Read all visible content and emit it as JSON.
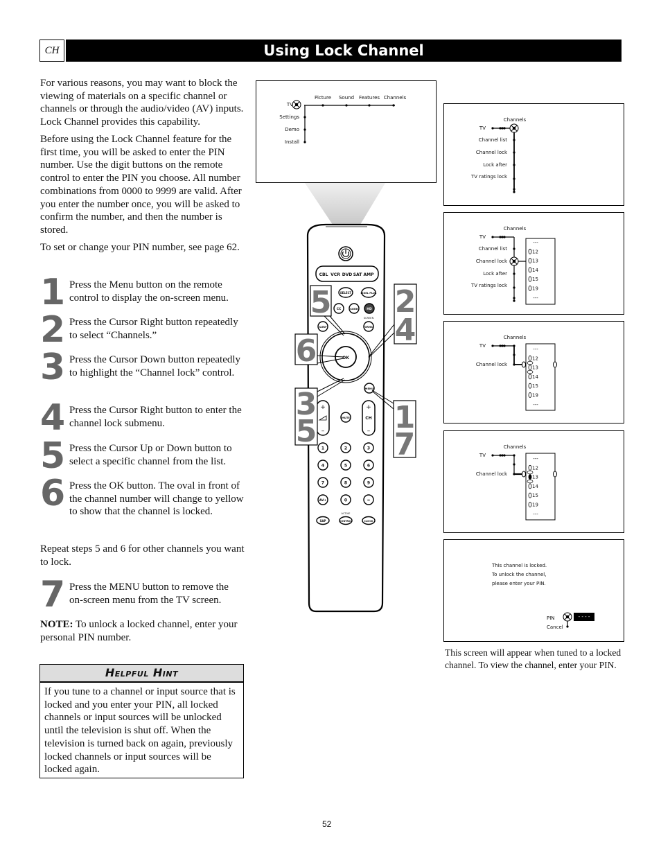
{
  "header": {
    "section_code": "CH",
    "title": "Using Lock Channel"
  },
  "intro": [
    "For various reasons, you may want to block the viewing of materials on a specific channel or channels or through the audio/video (AV) inputs. Lock Channel provides this capability.",
    "Before using the Lock Channel feature for the first time, you will be asked to enter the PIN number. Use the digit buttons on the remote control to enter the PIN you choose. All number combinations from 0000 to 9999 are valid. After you enter the number once, you will be asked to confirm the number, and then the number is stored.",
    "To set or change your PIN number, see page 62."
  ],
  "steps": [
    {
      "num": "1",
      "text": "Press the Menu button on the remote control to display the on-screen menu."
    },
    {
      "num": "2",
      "text": "Press the Cursor Right button repeatedly to select “Channels.”"
    },
    {
      "num": "3",
      "text": "Press the Cursor Down button repeatedly to highlight the “Channel lock” control."
    },
    {
      "num": "4",
      "text": "Press the Cursor Right button to enter the channel lock submenu."
    },
    {
      "num": "5",
      "text": "Press the Cursor Up or Down button to select a specific channel from the list."
    },
    {
      "num": "6",
      "text": "Press the OK button. The oval in front of the channel number will change to yellow to show that the channel is locked."
    }
  ],
  "repeat_note": "Repeat steps 5 and 6 for other channels you want to lock.",
  "step7": {
    "num": "7",
    "text": "Press the MENU button to remove the on-screen menu from the TV screen."
  },
  "note": {
    "label": "NOTE:",
    "text": " To unlock a locked channel, enter your personal PIN number."
  },
  "hint": {
    "title": "Helpful Hint",
    "text": "If you tune to a channel or input source that is locked and you enter your PIN, all locked channels or input sources will be unlocked until the television is shut off. When the television is turned back on again, previously locked channels or input sources will be locked again."
  },
  "screens": {
    "main_menu": {
      "root": "TV",
      "top_items": [
        "Picture",
        "Sound",
        "Features",
        "Channels"
      ],
      "side_items": [
        "Settings",
        "Demo",
        "Install"
      ]
    },
    "channels_menu": {
      "root": "TV",
      "title": "Channels",
      "items": [
        "Channel list",
        "Channel lock",
        "Lock after",
        "TV ratings lock"
      ]
    },
    "channel_list": [
      "---",
      "12",
      "13",
      "14",
      "15",
      "19",
      "---"
    ],
    "channel_lock_label": "Channel lock",
    "locked_screen": {
      "lines": [
        "This channel is locked.",
        "To unlock the channel,",
        "please enter your PIN."
      ],
      "pin_label": "PIN",
      "pin_value": "- - - -",
      "cancel_label": "Cancel"
    }
  },
  "remote": {
    "sources": [
      "CBL",
      "VCR",
      "DVD",
      "SAT",
      "AMP"
    ],
    "buttons": {
      "select": "SELECT",
      "pixel_plus": "PIXEL PLUS",
      "cc": "CC",
      "surr": "SURR",
      "hd": "HD",
      "surf": "SURF",
      "screen": "SCREEN",
      "format": "FORMAT",
      "ok": "OK",
      "menu": "MENU",
      "mute": "MUTE",
      "ch": "CH",
      "av": "AV+",
      "dash": "–",
      "sap": "SAP",
      "active": "ACTIVE",
      "control": "CONTROL",
      "clock": "CLOCK"
    },
    "digits": [
      "1",
      "2",
      "3",
      "4",
      "5",
      "6",
      "7",
      "8",
      "9",
      "0"
    ],
    "callouts": {
      "up": "5",
      "left": "6",
      "right": "2\n4",
      "down": "3\n5",
      "menu": "1\n7"
    }
  },
  "caption": "This screen will appear when tuned to a locked channel. To view the channel, enter your PIN.",
  "page_number": "52"
}
